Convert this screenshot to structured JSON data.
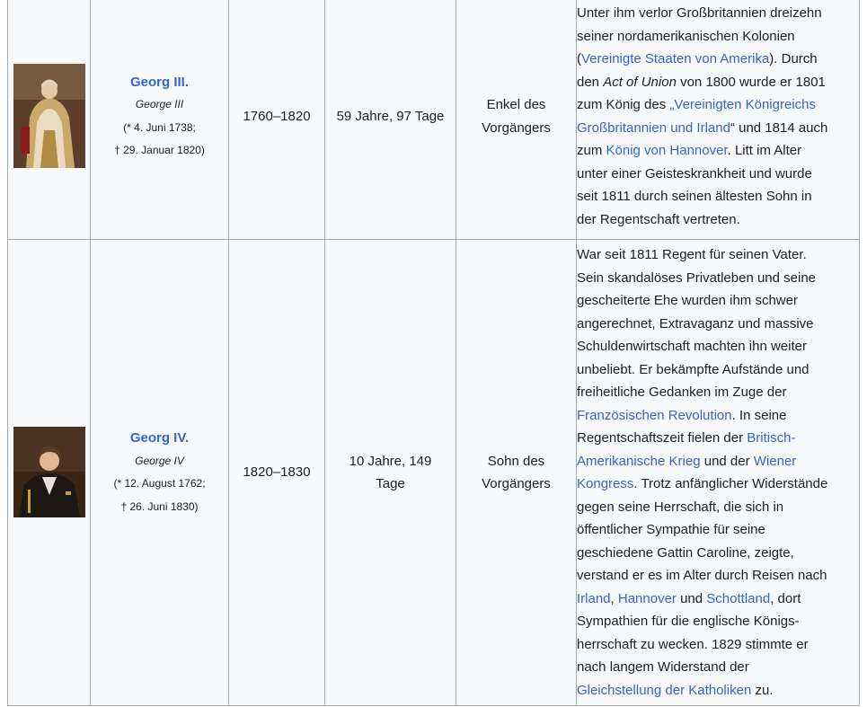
{
  "rows": [
    {
      "name": "Georg III.",
      "original_name": "George III",
      "born": "(* 4. Juni 1738;",
      "died": "† 29. Januar 1820)",
      "reign": "1760–1820",
      "duration": "59 Jahre, 97 Tage",
      "relation_line1": "Enkel des",
      "relation_line2": "Vorgängers",
      "note": [
        [
          {
            "t": "Unter ihm verlor Großbritannien dreizehn"
          }
        ],
        [
          {
            "t": "seiner nordamerikanischen Kolonien"
          }
        ],
        [
          {
            "t": "("
          },
          {
            "t": "Vereinigte Staaten von Amerika",
            "link": true
          },
          {
            "t": "). Durch"
          }
        ],
        [
          {
            "t": "den "
          },
          {
            "t": "Act of Union",
            "i": true
          },
          {
            "t": " von 1800 wurde er 1801"
          }
        ],
        [
          {
            "t": "zum König des "
          },
          {
            "t": "„Vereinigten Königreichs",
            "link": true
          }
        ],
        [
          {
            "t": "Großbritannien und Irland",
            "link": true
          },
          {
            "t": "“ und 1814 auch"
          }
        ],
        [
          {
            "t": "zum "
          },
          {
            "t": "König von Hannover",
            "link": true
          },
          {
            "t": ". Litt im Alter"
          }
        ],
        [
          {
            "t": "unter einer Geisteskrankheit und wurde"
          }
        ],
        [
          {
            "t": "seit 1811 durch seinen ältesten Sohn in"
          }
        ],
        [
          {
            "t": "der Regentschaft vertreten."
          }
        ]
      ]
    },
    {
      "name": "Georg IV.",
      "original_name": "George IV",
      "born": "(* 12. August 1762;",
      "died": "† 26. Juni 1830)",
      "reign": "1820–1830",
      "duration_line1": "10 Jahre, 149",
      "duration_line2": "Tage",
      "relation_line1": "Sohn des",
      "relation_line2": "Vorgängers",
      "note": [
        [
          {
            "t": "War seit 1811 Regent für seinen Vater."
          }
        ],
        [
          {
            "t": "Sein skandalöses Privatleben und seine"
          }
        ],
        [
          {
            "t": "gescheiterte Ehe wurden ihm schwer"
          }
        ],
        [
          {
            "t": "angerechnet, Extravaganz und massive"
          }
        ],
        [
          {
            "t": "Schuldenwirtschaft machten ihn weiter"
          }
        ],
        [
          {
            "t": "unbeliebt. Er bekämpfte Aufstände und"
          }
        ],
        [
          {
            "t": "freiheitliche Gedanken im Zuge der"
          }
        ],
        [
          {
            "t": "Französischen Revolution",
            "link": true
          },
          {
            "t": ". In seine"
          }
        ],
        [
          {
            "t": "Regentschaftszeit fielen der "
          },
          {
            "t": "Britisch-",
            "link": true
          }
        ],
        [
          {
            "t": "Amerikanische Krieg",
            "link": true
          },
          {
            "t": " und der "
          },
          {
            "t": "Wiener",
            "link": true
          }
        ],
        [
          {
            "t": "Kongress",
            "link": true
          },
          {
            "t": ". Trotz anfänglicher Widerstände"
          }
        ],
        [
          {
            "t": "gegen seine Herrschaft, die sich in"
          }
        ],
        [
          {
            "t": "öffentlicher Sympathie für seine"
          }
        ],
        [
          {
            "t": "geschiedene Gattin Caroline, zeigte,"
          }
        ],
        [
          {
            "t": "verstand er es im Alter durch Reisen nach"
          }
        ],
        [
          {
            "t": "Irland",
            "link": true
          },
          {
            "t": ", "
          },
          {
            "t": "Hannover",
            "link": true
          },
          {
            "t": " und "
          },
          {
            "t": "Schottland",
            "link": true
          },
          {
            "t": ", dort"
          }
        ],
        [
          {
            "t": "Sympathien für die englische Königs-"
          }
        ],
        [
          {
            "t": "herrschaft zu wecken. 1829 stimmte er"
          }
        ],
        [
          {
            "t": "nach langem Widerstand der"
          }
        ],
        [
          {
            "t": "Gleichstellung der Katholiken",
            "link": true
          },
          {
            "t": " zu."
          }
        ]
      ]
    }
  ],
  "colors": {
    "link": "#3366cc",
    "border": "#a2a9b1",
    "cell_bg": "#f8f9fa",
    "text": "#202122"
  }
}
